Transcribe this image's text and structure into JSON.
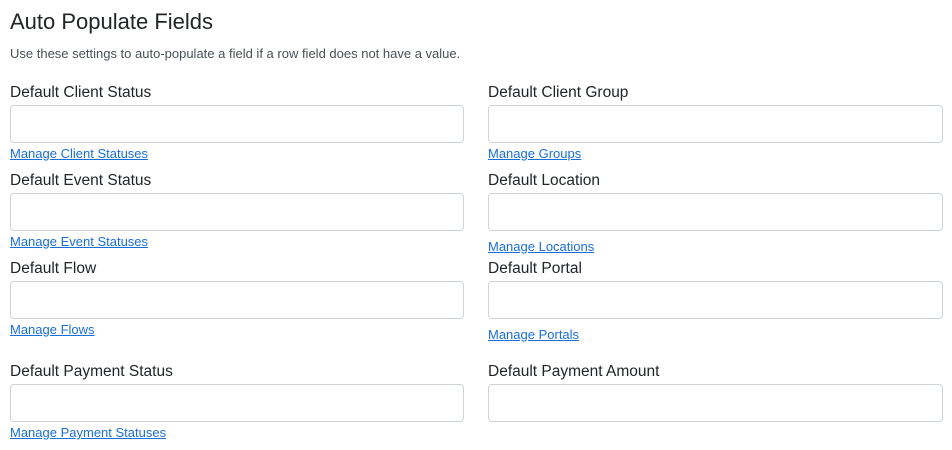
{
  "page": {
    "title": "Auto Populate Fields",
    "description": "Use these settings to auto-populate a field if a row field does not have a value."
  },
  "fields": {
    "client_status": {
      "label": "Default Client Status",
      "value": "",
      "link": "Manage Client Statuses"
    },
    "client_group": {
      "label": "Default Client Group",
      "value": "",
      "link": "Manage Groups"
    },
    "event_status": {
      "label": "Default Event Status",
      "value": "",
      "link": "Manage Event Statuses"
    },
    "location": {
      "label": "Default Location",
      "value": "",
      "link": "Manage Locations"
    },
    "flow": {
      "label": "Default Flow",
      "value": "",
      "link": "Manage Flows"
    },
    "portal": {
      "label": "Default Portal",
      "value": "",
      "link": "Manage Portals"
    },
    "payment_status": {
      "label": "Default Payment Status",
      "value": "",
      "link": "Manage Payment Statuses"
    },
    "payment_amount": {
      "label": "Default Payment Amount",
      "value": ""
    }
  },
  "colors": {
    "link": "#1a6fd6",
    "input_border": "#ced4da",
    "text": "#212529"
  }
}
